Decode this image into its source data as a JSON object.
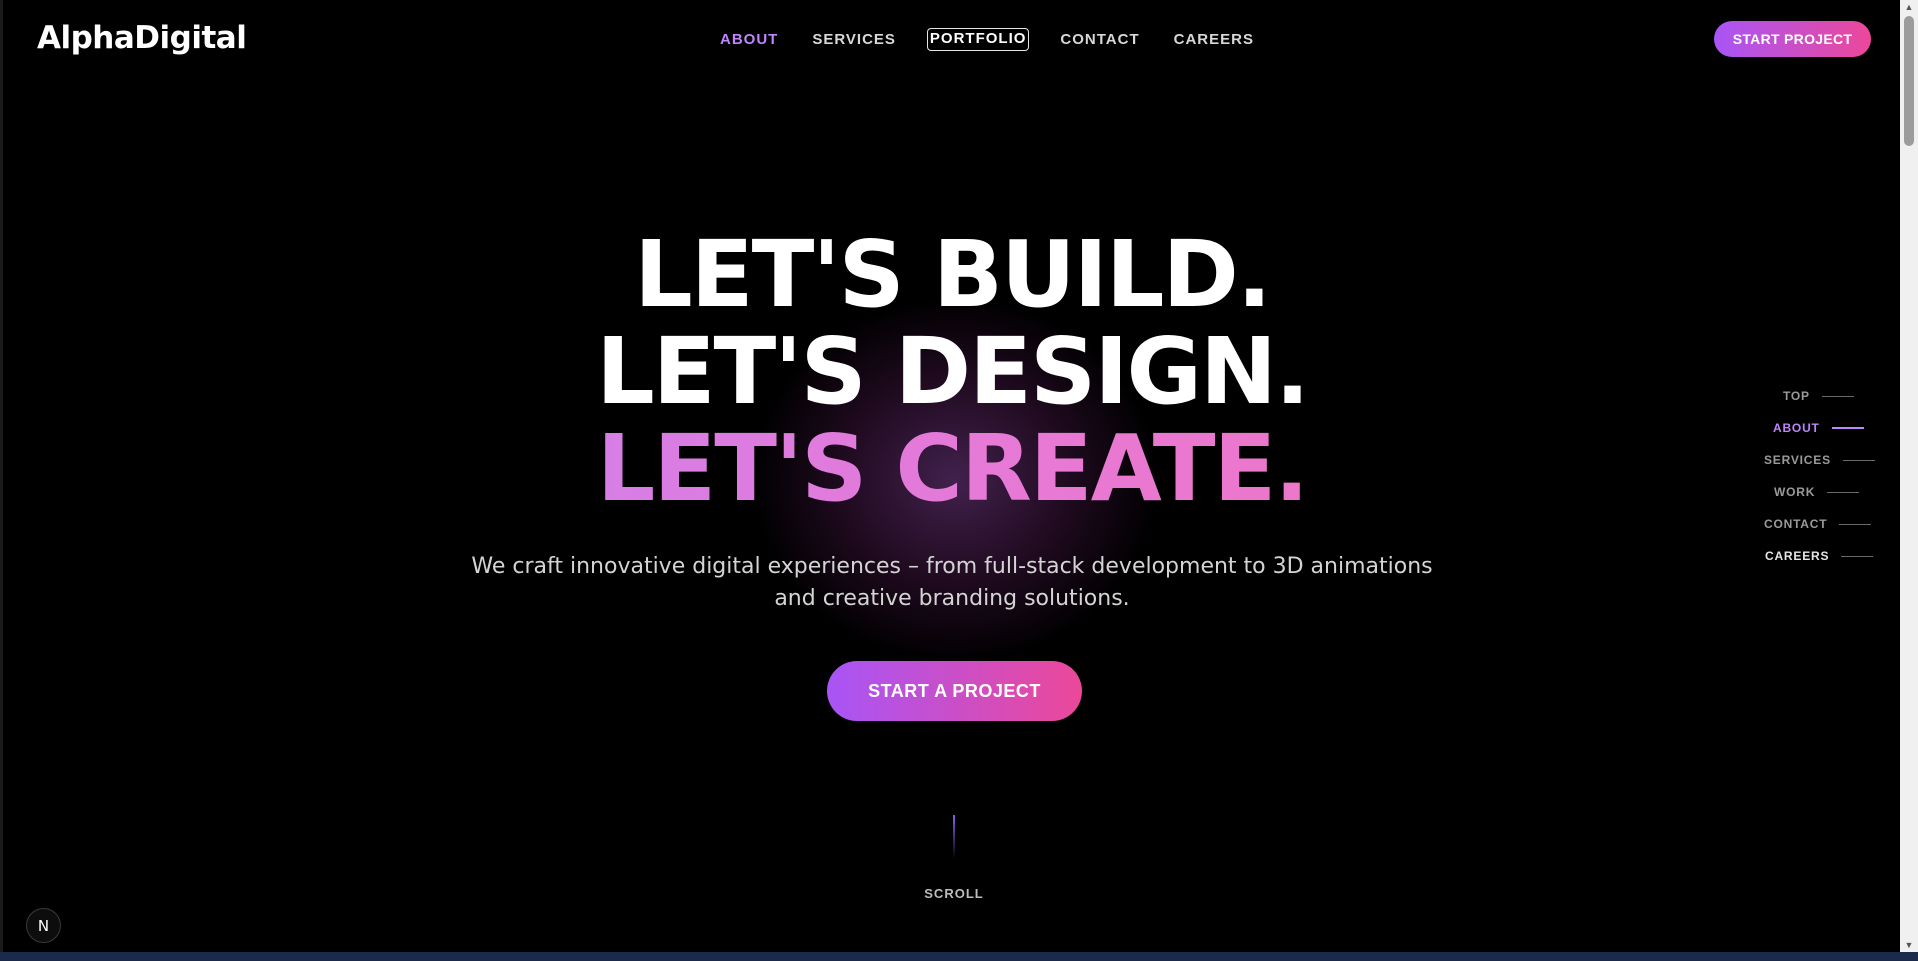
{
  "header": {
    "logo": "AlphaDigital",
    "nav": [
      {
        "label": "ABOUT",
        "state": "active"
      },
      {
        "label": "SERVICES",
        "state": "normal"
      },
      {
        "label": "PORTFOLIO",
        "state": "focused"
      },
      {
        "label": "CONTACT",
        "state": "normal"
      },
      {
        "label": "CAREERS",
        "state": "normal"
      }
    ],
    "cta_label": "START PROJECT"
  },
  "hero": {
    "line1": "LET'S BUILD.",
    "line2": "LET'S DESIGN.",
    "line3": "LET'S CREATE.",
    "subtitle_line1": "We craft innovative digital experiences – from full-stack development to 3D animations",
    "subtitle_line2": "and creative branding solutions.",
    "cta_label": "START A PROJECT"
  },
  "scroll": {
    "label": "SCROLL"
  },
  "side_nav": [
    {
      "label": "TOP"
    },
    {
      "label": "ABOUT"
    },
    {
      "label": "SERVICES"
    },
    {
      "label": "WORK"
    },
    {
      "label": "CONTACT"
    },
    {
      "label": "CAREERS"
    }
  ],
  "badge": {
    "label": "N"
  },
  "colors": {
    "accent_purple": "#a855f7",
    "accent_pink": "#ec4899",
    "active_nav": "#c084fc",
    "background": "#000000"
  },
  "icons": {
    "scroll_up": "triangle-up-icon",
    "scroll_down": "triangle-down-icon"
  }
}
